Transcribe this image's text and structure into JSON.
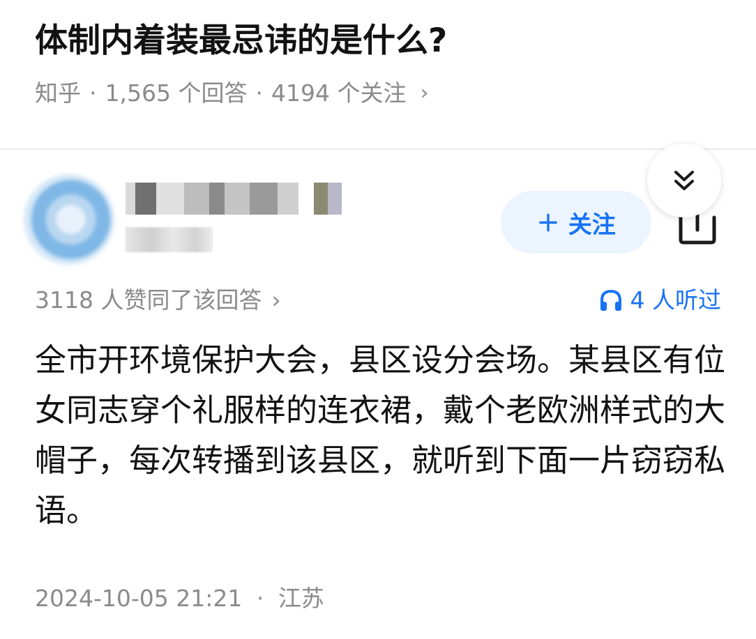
{
  "question": {
    "title": "体制内着装最忌讳的是什么?",
    "source": "知乎",
    "answers_count": "1,565 个回答",
    "followers_count": "4194 个关注",
    "separator": "·",
    "chevron": "›"
  },
  "author": {
    "name_redacted": true,
    "follow_button": {
      "icon": "+",
      "label": "关注"
    }
  },
  "answer": {
    "agree_text": "3118 人赞同了该回答",
    "agree_chevron": "›",
    "listen_text": "4 人听过",
    "body": "全市开环境保护大会，县区设分会场。某县区有位女同志穿个礼服样的连衣裙，戴个老欧洲样式的大帽子，每次转播到该县区，就听到下面一片窃窃私语。",
    "timestamp": "2024-10-05 21:21",
    "location": "江苏",
    "separator": "·"
  },
  "icons": {
    "collapse": "double-chevron-down-icon",
    "share": "share-icon",
    "headphones": "headphones-icon"
  },
  "colors": {
    "accent": "#1772f6",
    "follow_bg": "#ebf4ff",
    "meta_gray": "#8a8a8a"
  }
}
